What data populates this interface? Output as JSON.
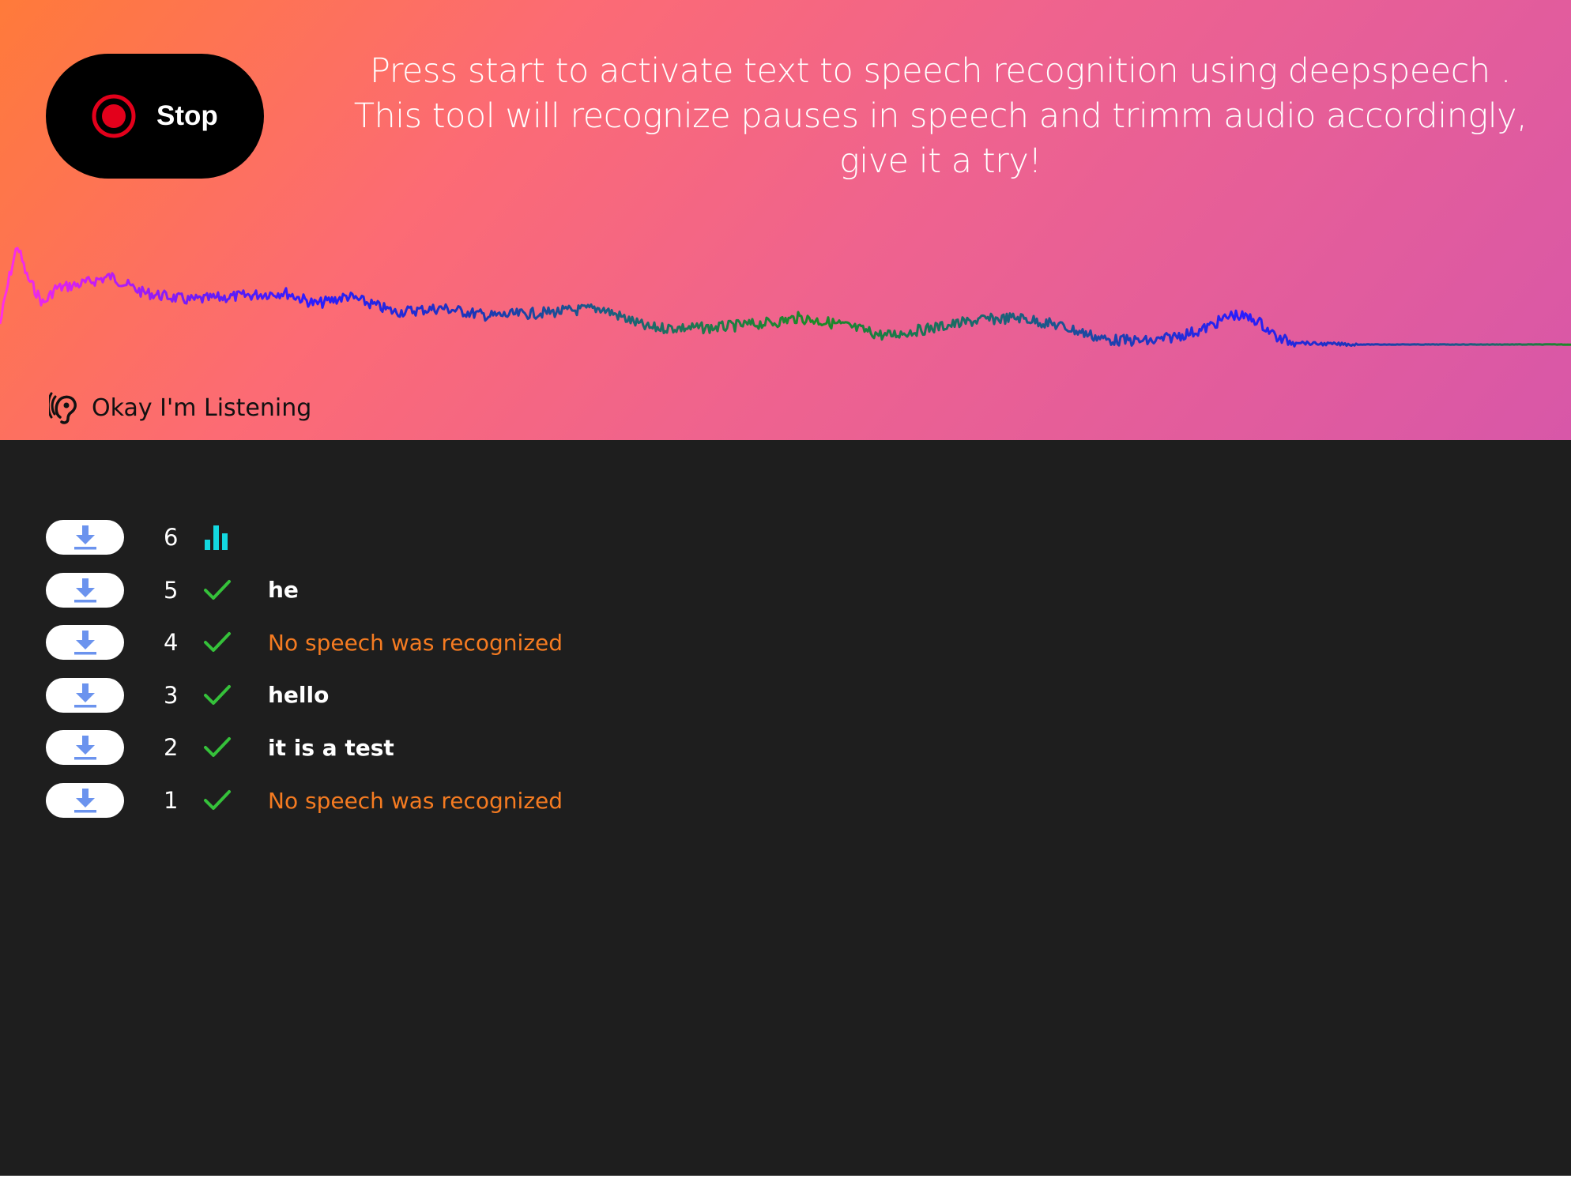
{
  "header": {
    "stop_label": "Stop",
    "instructions": [
      "Press start to activate text to speech recognition using deepspeech .",
      "This tool will recognize pauses in speech and trimm audio accordingly,",
      "give it a try!"
    ],
    "listening_label": "Okay I'm Listening"
  },
  "icons": {
    "record": "record-icon",
    "ear": "ear-icon",
    "download": "download-icon",
    "done": "checkmark-icon",
    "processing": "bar-chart-icon"
  },
  "colors": {
    "gradient_start": "#ff7a3a",
    "gradient_end": "#d857a8",
    "panel_bg": "#1e1e1e",
    "record_red": "#e3001b",
    "check_green": "#35c13a",
    "processing_cyan": "#13d8e0",
    "download_blue": "#6b93ee",
    "warning_orange": "#f57b21"
  },
  "results": [
    {
      "index": "6",
      "status": "processing",
      "text": "",
      "kind": "normal"
    },
    {
      "index": "5",
      "status": "done",
      "text": "he",
      "kind": "normal"
    },
    {
      "index": "4",
      "status": "done",
      "text": "No speech was recognized",
      "kind": "warn"
    },
    {
      "index": "3",
      "status": "done",
      "text": "hello",
      "kind": "normal"
    },
    {
      "index": "2",
      "status": "done",
      "text": "it is a test",
      "kind": "normal"
    },
    {
      "index": "1",
      "status": "done",
      "text": "No speech was recognized",
      "kind": "warn"
    }
  ]
}
